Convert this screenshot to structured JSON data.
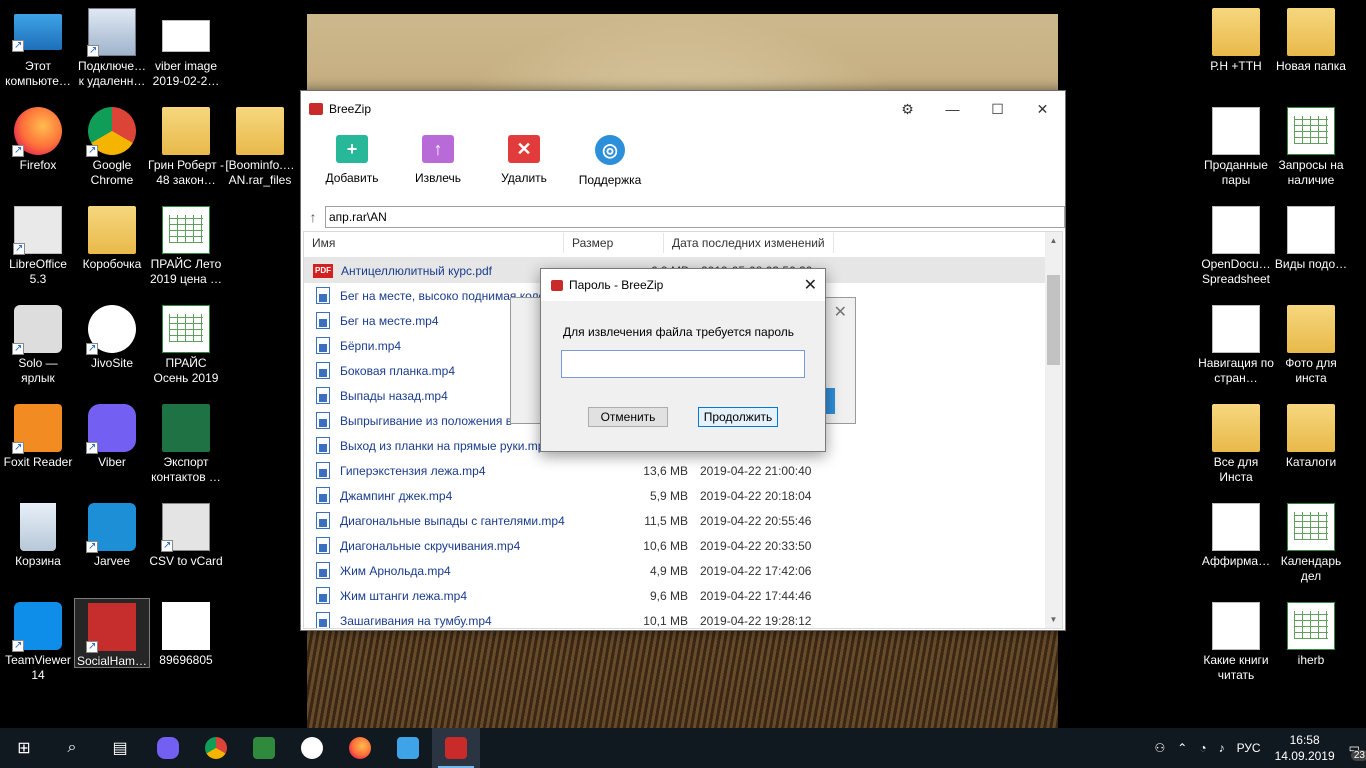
{
  "desktop_left": [
    {
      "label": "Этот компьюте…",
      "icon": "computer-icon",
      "x": 0,
      "y": 0
    },
    {
      "label": "Подключе… к удаленн…",
      "icon": "remote-desktop-icon",
      "x": 1,
      "y": 0
    },
    {
      "label": "viber image 2019-02-2…",
      "icon": "image-file-icon",
      "x": 2,
      "y": 0
    },
    {
      "label": "Firefox",
      "icon": "firefox-icon"
    },
    {
      "label": "Google Chrome",
      "icon": "chrome-icon"
    },
    {
      "label": "Грин Роберт - 48 закон…",
      "icon": "folder-icon"
    },
    {
      "label": "[Boominfo.… AN.rar_files",
      "icon": "folder-icon"
    },
    {
      "label": "LibreOffice 5.3",
      "icon": "libreoffice-icon"
    },
    {
      "label": "Коробочка",
      "icon": "folder-icon"
    },
    {
      "label": "ПРАЙС Лето 2019 цена …",
      "icon": "spreadsheet-icon"
    },
    {
      "label": "Solo — ярлык",
      "icon": "solo-icon"
    },
    {
      "label": "JivoSite",
      "icon": "jivosite-icon"
    },
    {
      "label": "ПРАЙС Осень 2019",
      "icon": "spreadsheet-icon"
    },
    {
      "label": "Foxit Reader",
      "icon": "foxit-icon"
    },
    {
      "label": "Viber",
      "icon": "viber-icon"
    },
    {
      "label": "Экспорт контактов …",
      "icon": "excel-icon"
    },
    {
      "label": "Корзина",
      "icon": "recycle-bin-icon"
    },
    {
      "label": "Jarvee",
      "icon": "jarvee-icon"
    },
    {
      "label": "CSV to vCard",
      "icon": "vcard-icon"
    },
    {
      "label": "TeamViewer 14",
      "icon": "teamviewer-icon"
    },
    {
      "label": "SocialHam…",
      "icon": "socialhammer-icon"
    },
    {
      "label": "89696805",
      "icon": "image-file-icon"
    }
  ],
  "desktop_right": [
    {
      "label": "Р.Н +ТТН",
      "icon": "folder-icon"
    },
    {
      "label": "Новая папка",
      "icon": "folder-icon"
    },
    {
      "label": "Проданные пары",
      "icon": "document-icon"
    },
    {
      "label": "Запросы на наличие",
      "icon": "spreadsheet-icon"
    },
    {
      "label": "OpenDocu… Spreadsheet",
      "icon": "document-icon"
    },
    {
      "label": "Виды подо…",
      "icon": "document-icon"
    },
    {
      "label": "Навигация по стран…",
      "icon": "document-icon"
    },
    {
      "label": "Фото для инста",
      "icon": "folder-icon"
    },
    {
      "label": "Все для Инста",
      "icon": "folder-icon"
    },
    {
      "label": "Каталоги",
      "icon": "folder-icon"
    },
    {
      "label": "Аффирма…",
      "icon": "document-icon"
    },
    {
      "label": "Календарь дел",
      "icon": "spreadsheet-icon"
    },
    {
      "label": "Какие книги читать",
      "icon": "document-icon"
    },
    {
      "label": "iherb",
      "icon": "spreadsheet-icon"
    }
  ],
  "window": {
    "title": "BreeZip",
    "toolbar": {
      "add": "Добавить",
      "extract": "Извлечь",
      "delete": "Удалить",
      "support": "Поддержка"
    },
    "path": "апр.rar\\AN",
    "columns": {
      "name": "Имя",
      "size": "Размер",
      "date": "Дата последних изменений"
    },
    "files": [
      {
        "name": "Антицеллюлитный курс.pdf",
        "size": "6,9 MB",
        "date": "2019-05-08 03:50:30",
        "type": "pdf"
      },
      {
        "name": "Бег на месте, высоко поднимая коле",
        "size": "",
        "date": "",
        "type": "video"
      },
      {
        "name": "Бег на месте.mp4",
        "size": "",
        "date": "",
        "type": "video"
      },
      {
        "name": "Бёрпи.mp4",
        "size": "",
        "date": "",
        "type": "video"
      },
      {
        "name": "Боковая планка.mp4",
        "size": "",
        "date": "",
        "type": "video"
      },
      {
        "name": "Выпады назад.mp4",
        "size": "",
        "date": "",
        "type": "video"
      },
      {
        "name": "Выпрыгивание из положения в",
        "size": "",
        "date": "",
        "type": "video"
      },
      {
        "name": "Выход из планки на прямые руки.mp",
        "size": "",
        "date": "",
        "type": "video"
      },
      {
        "name": "Гиперэкстензия лежа.mp4",
        "size": "13,6 MB",
        "date": "2019-04-22 21:00:40",
        "type": "video"
      },
      {
        "name": "Джампинг джек.mp4",
        "size": "5,9 MB",
        "date": "2019-04-22 20:18:04",
        "type": "video"
      },
      {
        "name": "Диагональные выпады с гантелями.mp4",
        "size": "11,5 MB",
        "date": "2019-04-22 20:55:46",
        "type": "video"
      },
      {
        "name": "Диагональные скручивания.mp4",
        "size": "10,6 MB",
        "date": "2019-04-22 20:33:50",
        "type": "video"
      },
      {
        "name": "Жим Арнольда.mp4",
        "size": "4,9 MB",
        "date": "2019-04-22 17:42:06",
        "type": "video"
      },
      {
        "name": "Жим штанги лежа.mp4",
        "size": "9,6 MB",
        "date": "2019-04-22 17:44:46",
        "type": "video"
      },
      {
        "name": "Зашагивания на тумбу.mp4",
        "size": "10,1 MB",
        "date": "2019-04-22 19:28:12",
        "type": "video"
      }
    ]
  },
  "dialog": {
    "title": "Пароль - BreeZip",
    "message": "Для извлечения файла требуется пароль",
    "password_value": "",
    "cancel": "Отменить",
    "continue": "Продолжить"
  },
  "taskbar": {
    "lang": "РУС",
    "time": "16:58",
    "date": "14.09.2019",
    "notifications": "23"
  }
}
